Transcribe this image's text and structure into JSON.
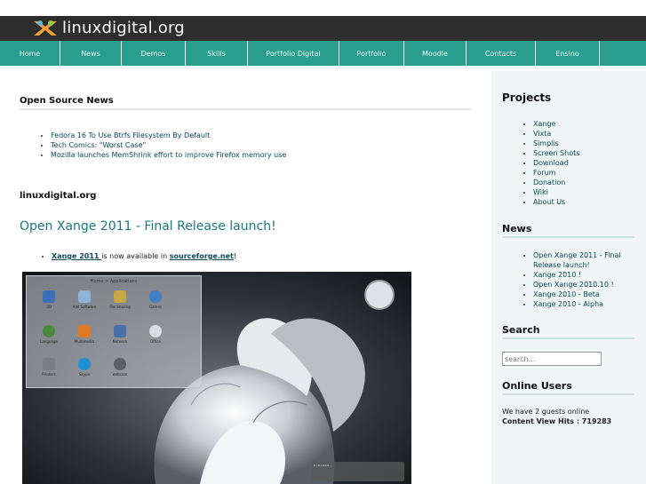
{
  "site": {
    "logo_text": "linuxdigital.org"
  },
  "nav": [
    "Home",
    "News",
    "Demos",
    "Skills",
    "Portfolio Digital",
    "Portfolio",
    "Moodle",
    "Contacts",
    "Ensino"
  ],
  "main": {
    "news_title": "Open Source News",
    "news_items": [
      "Fedora 16 To Use Btrfs Filesystem By Default",
      "Tech Comics: \"Worst Case\"",
      "Mozilla launches MemShrink effort to improve Firefox memory use"
    ],
    "site_heading": "linuxdigital.org",
    "article_title": "Open Xange 2011 - Final Release launch!",
    "article_link": "Xange 2011 ",
    "article_text_mid": "is now available in ",
    "article_link2": "sourceforge.net",
    "article_text_end": "!"
  },
  "screenshot": {
    "overlay_title": "Home > Applications",
    "apps": [
      "3D",
      "Add Software",
      "File Sharing",
      "Games",
      "Language",
      "Multimedia",
      "Network",
      "Office",
      "Printers",
      "Skype",
      "webcam"
    ],
    "notification": "0 / 0 / 0.0.0 ..."
  },
  "sidebar": {
    "projects_title": "Projects",
    "projects": [
      "Xange",
      "Vixta",
      "Simplis",
      "Screen Shots",
      "Download",
      "Forum",
      "Donation",
      "Wiki",
      "About Us"
    ],
    "news_title": "News",
    "news": [
      "Open Xange 2011 - Final Release launch!",
      "Xange 2010 !",
      "Open Xange 2010.10 !",
      "Xange 2010 - Beta",
      "Xange 2010 - Alpha"
    ],
    "search_title": "Search",
    "search_placeholder": "search...",
    "online_title": "Online Users",
    "online_text": "We have 2 guests online",
    "hits_label": "Content View Hits : 719283"
  },
  "colors": {
    "header": "#2d2d2d",
    "nav": "#2a9e8e",
    "title": "#1b7880",
    "link": "#0b4b59"
  }
}
